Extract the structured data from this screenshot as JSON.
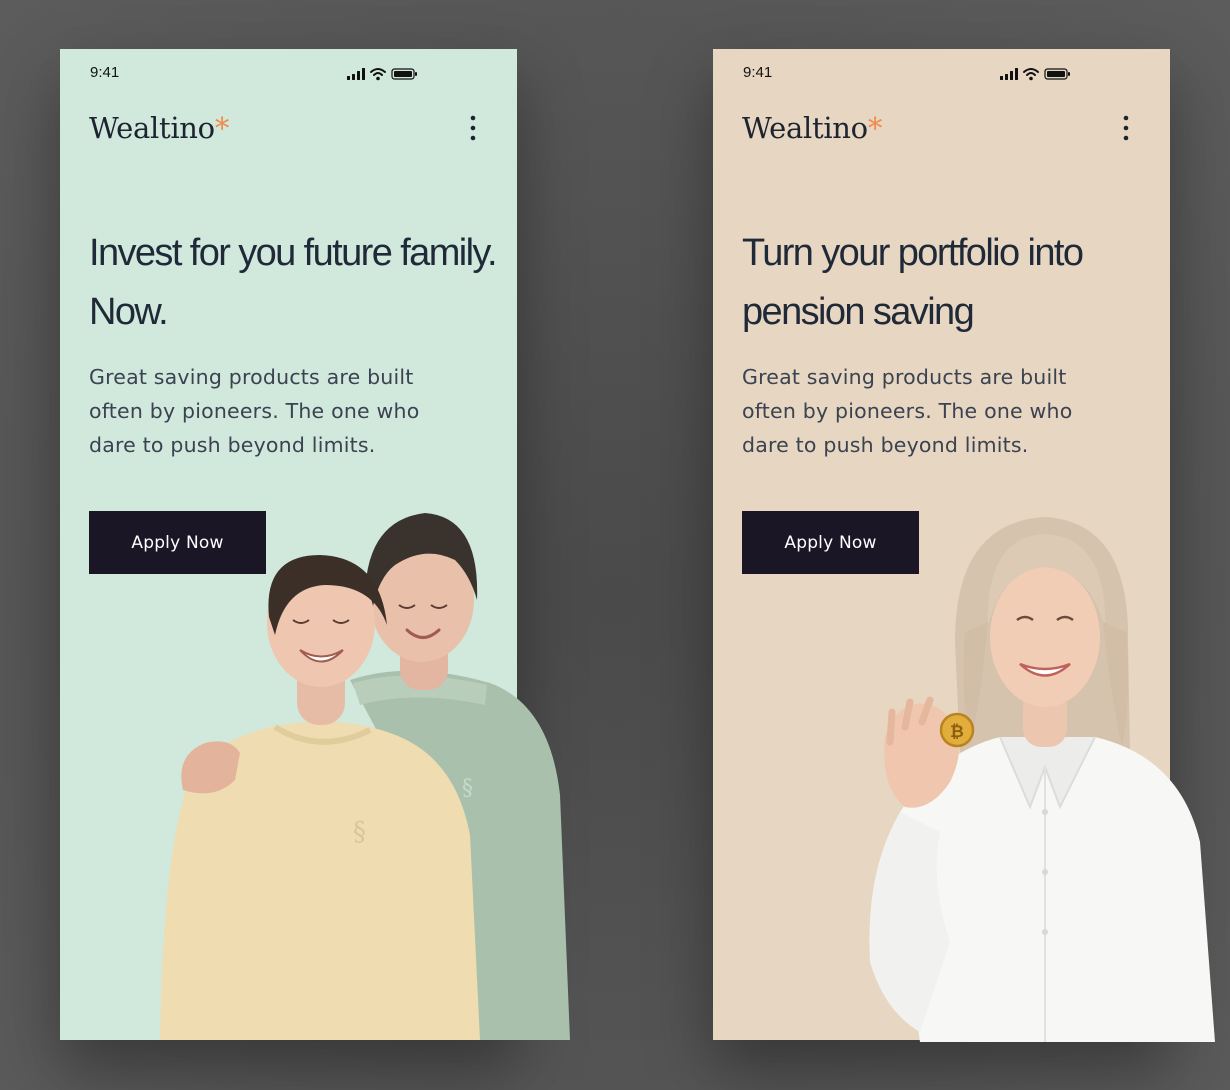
{
  "screens": [
    {
      "status_time": "9:41",
      "brand_name": "Wealtino",
      "brand_mark": "*",
      "menu_icon": "kebab-menu-icon",
      "headline": "Invest for you future family. Now.",
      "subtitle": "Great saving products are built often by pioneers. The one who dare to push beyond limits.",
      "cta_label": "Apply Now",
      "background": "#d1e8dc"
    },
    {
      "status_time": "9:41",
      "brand_name": "Wealtino",
      "brand_mark": "*",
      "menu_icon": "kebab-menu-icon",
      "headline": "Turn your portfolio into pension saving",
      "subtitle": "Great saving products are built often by pioneers. The one who dare to push beyond limits.",
      "cta_label": "Apply Now",
      "background": "#e6d6c2"
    }
  ],
  "colors": {
    "page_background": "#555555",
    "brand_accent": "#f08a4b",
    "cta_background": "#1a1625",
    "text_dark": "#1f2937"
  }
}
